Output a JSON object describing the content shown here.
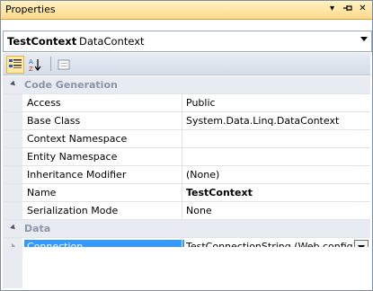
{
  "window": {
    "title": "Properties"
  },
  "title_icons": [
    "dropdown-icon",
    "pin-icon",
    "close-icon"
  ],
  "object_selector": {
    "name": "TestContext",
    "type": "DataContext"
  },
  "toolbar": {
    "buttons": [
      {
        "icon": "categorized-icon",
        "active": true
      },
      {
        "icon": "alphabetical-icon",
        "active": false
      },
      {
        "icon": "property-pages-icon",
        "active": false
      }
    ]
  },
  "grid": {
    "categories": [
      {
        "label": "Code Generation",
        "expanded": true,
        "properties": [
          {
            "name": "Access",
            "value": "Public"
          },
          {
            "name": "Base Class",
            "value": "System.Data.Linq.DataContext"
          },
          {
            "name": "Context Namespace",
            "value": ""
          },
          {
            "name": "Entity Namespace",
            "value": ""
          },
          {
            "name": "Inheritance Modifier",
            "value": "(None)"
          },
          {
            "name": "Name",
            "value": "TestContext",
            "bold": true
          },
          {
            "name": "Serialization Mode",
            "value": "None"
          }
        ]
      },
      {
        "label": "Data",
        "expanded": true,
        "properties": [
          {
            "name": "Connection",
            "value": "TestConnectionString (Web.config)",
            "selected": true,
            "has_dropdown": true
          }
        ]
      }
    ]
  },
  "colors": {
    "title_bar": "#ffd98a",
    "selection": "#3399ff",
    "category_text": "#8a96a8"
  }
}
